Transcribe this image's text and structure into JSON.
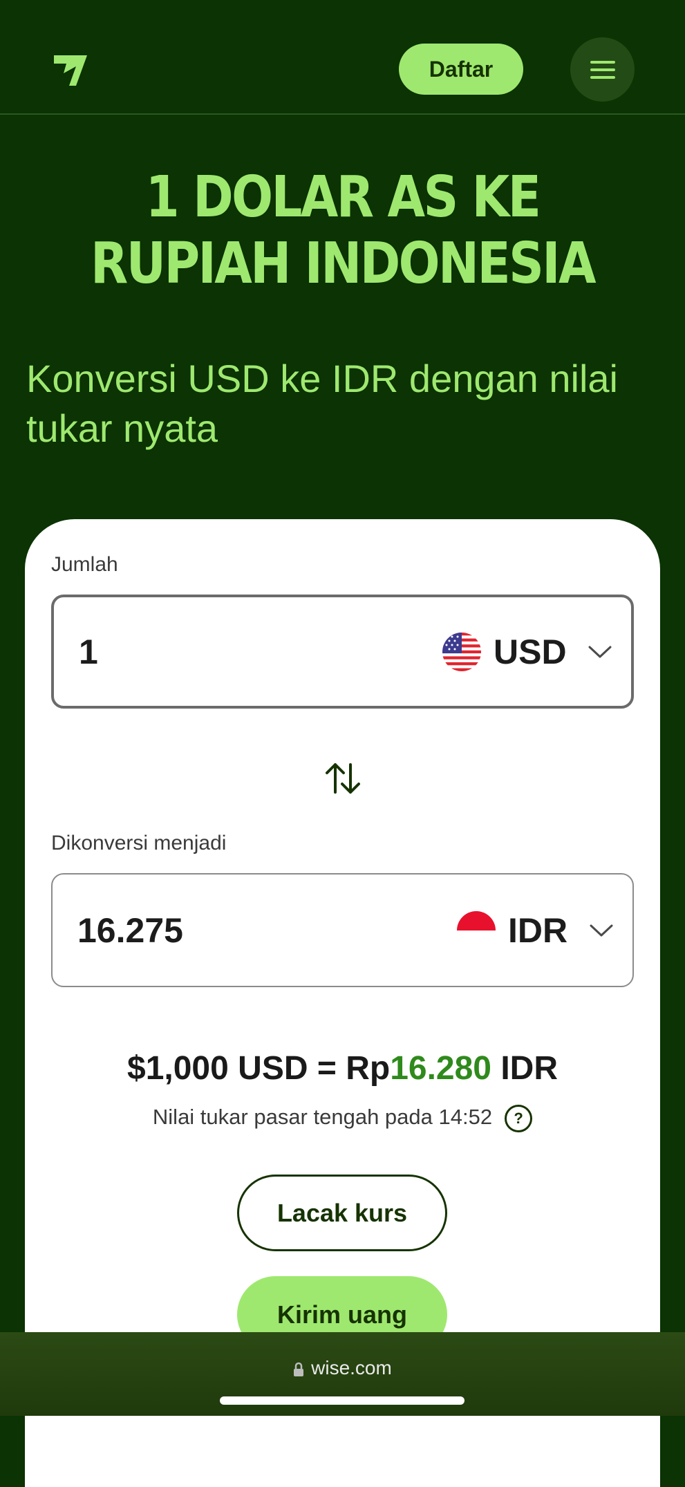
{
  "header": {
    "logo_icon": "wise-logo",
    "signup_label": "Daftar",
    "menu_icon": "hamburger-menu-icon"
  },
  "hero": {
    "title_line1": "1 DOLAR AS KE",
    "title_line2": "RUPIAH INDONESIA",
    "subtitle_line1": "Konversi USD ke IDR dengan nilai",
    "subtitle_line2": "tukar nyata"
  },
  "converter": {
    "amount_label": "Jumlah",
    "amount_value": "1",
    "from_currency": "USD",
    "from_flag": "us-flag-icon",
    "swap_icon": "swap-arrows-icon",
    "converted_label": "Dikonversi menjadi",
    "converted_value": "16.275",
    "to_currency": "IDR",
    "to_flag": "indonesia-flag-icon"
  },
  "rate": {
    "left": "$1,000 USD = Rp",
    "highlight": "16.280",
    "right": " IDR",
    "note": "Nilai tukar pasar tengah pada 14:52",
    "help_icon": "question-icon"
  },
  "actions": {
    "track_label": "Lacak kurs",
    "send_label": "Kirim uang"
  },
  "browser": {
    "url": "wise.com",
    "lock_icon": "lock-icon"
  },
  "colors": {
    "background": "#0b3303",
    "accent": "#9fe870",
    "dark_green": "#163300",
    "rate_green": "#2f8a1c"
  }
}
